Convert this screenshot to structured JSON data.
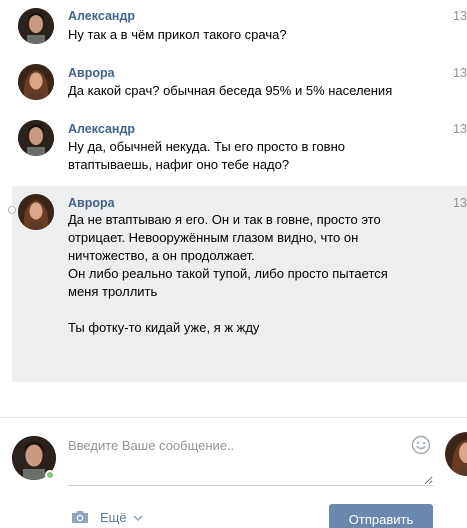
{
  "messages": [
    {
      "author": "Александр",
      "time": "13",
      "text": "Ну так а в чём прикол такого срача?"
    },
    {
      "author": "Аврора",
      "time": "13",
      "text": "Да какой срач? обычная беседа 95% и 5% населения"
    },
    {
      "author": "Александр",
      "time": "13",
      "text": "Ну да, обычней некуда. Ты его просто в говно\nвтаптываешь, нафиг оно тебе надо?"
    },
    {
      "author": "Аврора",
      "time": "13",
      "text": "Да не втаптываю я его. Он и так в говне, просто это\nотрицает. Невооружённым глазом видно, что он\nничтожество, а он продолжает.\nОн либо реально такой тупой, либо просто пытается\nменя троллить\n\nТы фотку-то кидай уже, я ж жду"
    }
  ],
  "composer": {
    "placeholder": "Введите Ваше сообщение..",
    "more_label": "Ещё",
    "send_label": "Отправить"
  },
  "colors": {
    "author": "#42648b",
    "highlight_bg": "#edeef0",
    "send_button": "#6888ad",
    "online": "#8ac176"
  },
  "icons": [
    "smile-icon",
    "camera-icon",
    "chevron-down-icon",
    "select-marker-icon"
  ]
}
